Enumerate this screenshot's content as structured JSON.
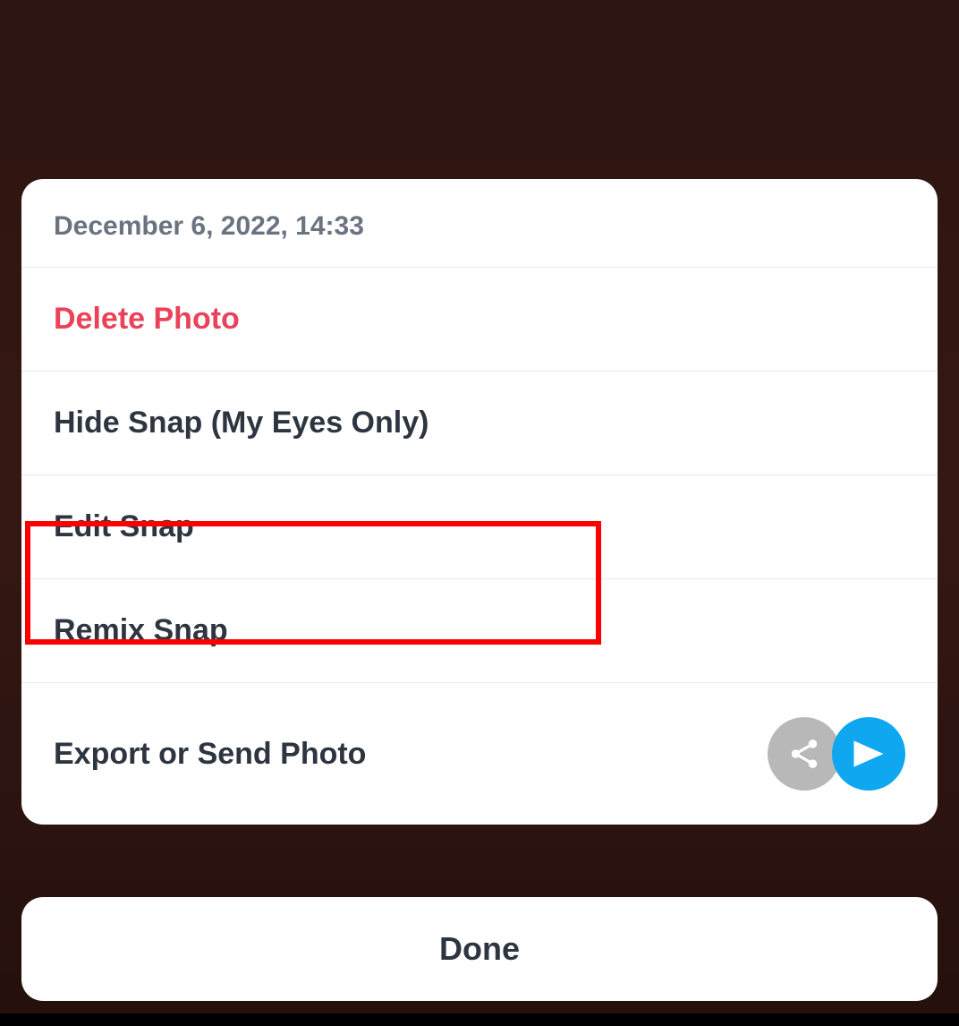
{
  "sheet": {
    "timestamp": "December 6, 2022, 14:33",
    "items": {
      "delete": "Delete Photo",
      "hide": "Hide Snap (My Eyes Only)",
      "edit": "Edit Snap",
      "remix": "Remix Snap",
      "export": "Export or Send Photo"
    }
  },
  "done_label": "Done",
  "colors": {
    "destructive": "#ea4259",
    "primary_text": "#2d3540",
    "secondary_text": "#6a7380",
    "send_blue": "#0ea7f0",
    "share_gray": "#b8b8b8"
  },
  "highlight": {
    "target": "edit"
  }
}
